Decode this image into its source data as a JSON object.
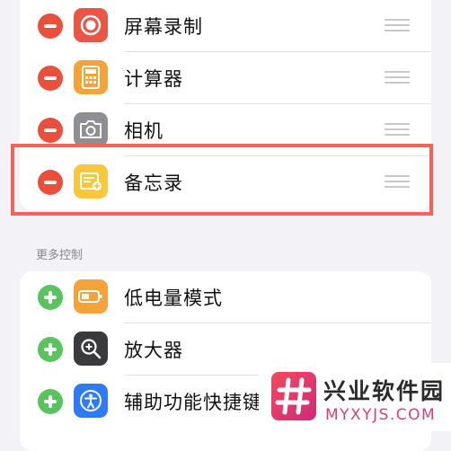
{
  "included_controls": {
    "items": [
      {
        "label": "屏幕录制",
        "icon": "screen-record-icon",
        "icon_color": "#eb5545"
      },
      {
        "label": "计算器",
        "icon": "calculator-icon",
        "icon_color": "#f3a33a"
      },
      {
        "label": "相机",
        "icon": "camera-icon",
        "icon_color": "#8e8e93"
      },
      {
        "label": "备忘录",
        "icon": "notes-icon",
        "icon_color": "#f7c73d"
      }
    ]
  },
  "more_controls": {
    "header": "更多控制",
    "items": [
      {
        "label": "低电量模式",
        "icon": "low-power-battery-icon",
        "icon_color": "#f3a33a"
      },
      {
        "label": "放大器",
        "icon": "magnifier-icon",
        "icon_color": "#3a3a3c"
      },
      {
        "label": "辅助功能快捷键",
        "icon": "accessibility-icon",
        "icon_color": "#2f7bf6"
      }
    ]
  },
  "colors": {
    "remove": "#ea4e3d",
    "add": "#5ac35f",
    "highlight": "#f2635c"
  },
  "watermark": {
    "title": "兴业软件园",
    "url": "MYXYJS.COM"
  }
}
